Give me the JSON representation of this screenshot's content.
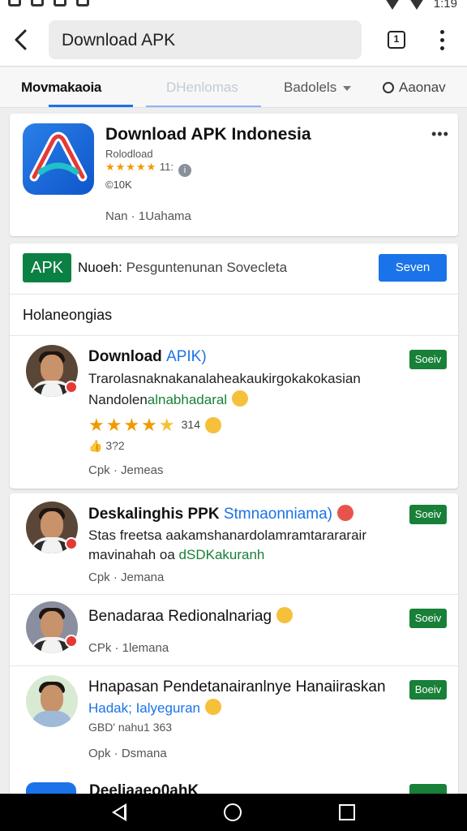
{
  "statusbar": {
    "time": "1:19"
  },
  "toolbar": {
    "search_value": "Download APK",
    "tabs_count": "1"
  },
  "tabstrip": {
    "tabs": [
      {
        "label": "Movmakaoia"
      },
      {
        "label": "DHenlomas"
      },
      {
        "label": "Badolels"
      },
      {
        "label": "Aaonav"
      }
    ]
  },
  "app": {
    "title": "Download APK Indonesia",
    "subtitle": "Rolodload",
    "rating_text": "11:",
    "downloads": "©10K",
    "meta": "Nan · 1Uahama",
    "colors": {
      "icon": "#1a6fe0",
      "red": "#e53935",
      "teal": "#20c1c9"
    }
  },
  "filter": {
    "badge": "APK",
    "label_bold": "Nuoeh:",
    "label_rest": "Pesguntenunan Sovecleta",
    "button": "Seven"
  },
  "section_title": "Holaneongias",
  "reviews": [
    {
      "name": "Download",
      "tag": "APIK)",
      "line1": "Trarolasnaknakanalaheakaukirgokakokasian",
      "line2_prefix": "Nandolen",
      "line2_highlight": "alnabhadaral",
      "rating_count": "314",
      "likes": "👍 3?2",
      "meta": "Cpk · Jemeas",
      "chip": "Soeiv"
    },
    {
      "name": "Deskalinghis PPK",
      "tag": "Stmnaonniama)",
      "line1": "Stas freetsa aakamshanardolamramtarararair",
      "line2_prefix": "mavinahah oa",
      "line2_highlight": "dSDKakuranh",
      "meta": "Cpk · Jemana",
      "chip": "Soeiv"
    },
    {
      "name": "Benadaraa Redionalnariag",
      "meta": "CPk · 1lemana",
      "chip": "Soeiv"
    },
    {
      "name": "Hnapasan Pendetanairanlnye Hanaiiraskan",
      "line1": "Hadak; Ialyeguran",
      "small": "GBD' nahu1 363",
      "meta": "Opk · Dsmana",
      "chip": "Boeiv"
    }
  ],
  "peek": {
    "text": "Deeliaaeo0ahK"
  }
}
